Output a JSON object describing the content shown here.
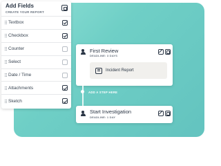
{
  "panel": {
    "title": "Add Fields",
    "subtitle": "CREATE YOUR REPORT",
    "header_icon": "copy-icon",
    "fields": [
      {
        "label": "Textbox",
        "checked": true
      },
      {
        "label": "Checkbox",
        "checked": true
      },
      {
        "label": "Counter",
        "checked": false
      },
      {
        "label": "Select",
        "checked": false
      },
      {
        "label": "Date / Time",
        "checked": false
      },
      {
        "label": "Attachments",
        "checked": true
      },
      {
        "label": "Sketch",
        "checked": true
      }
    ]
  },
  "steps": [
    {
      "title": "First Review",
      "deadline": "DEADLINE: 3 DAYS",
      "form": "Incident Report"
    },
    {
      "title": "Start Investigation",
      "deadline": "DEADLINE: 1 DAY"
    }
  ],
  "connector": {
    "add_label": "ADD A STEP HERE"
  },
  "colors": {
    "accent": "#6fcfc6",
    "text": "#2b3645"
  }
}
